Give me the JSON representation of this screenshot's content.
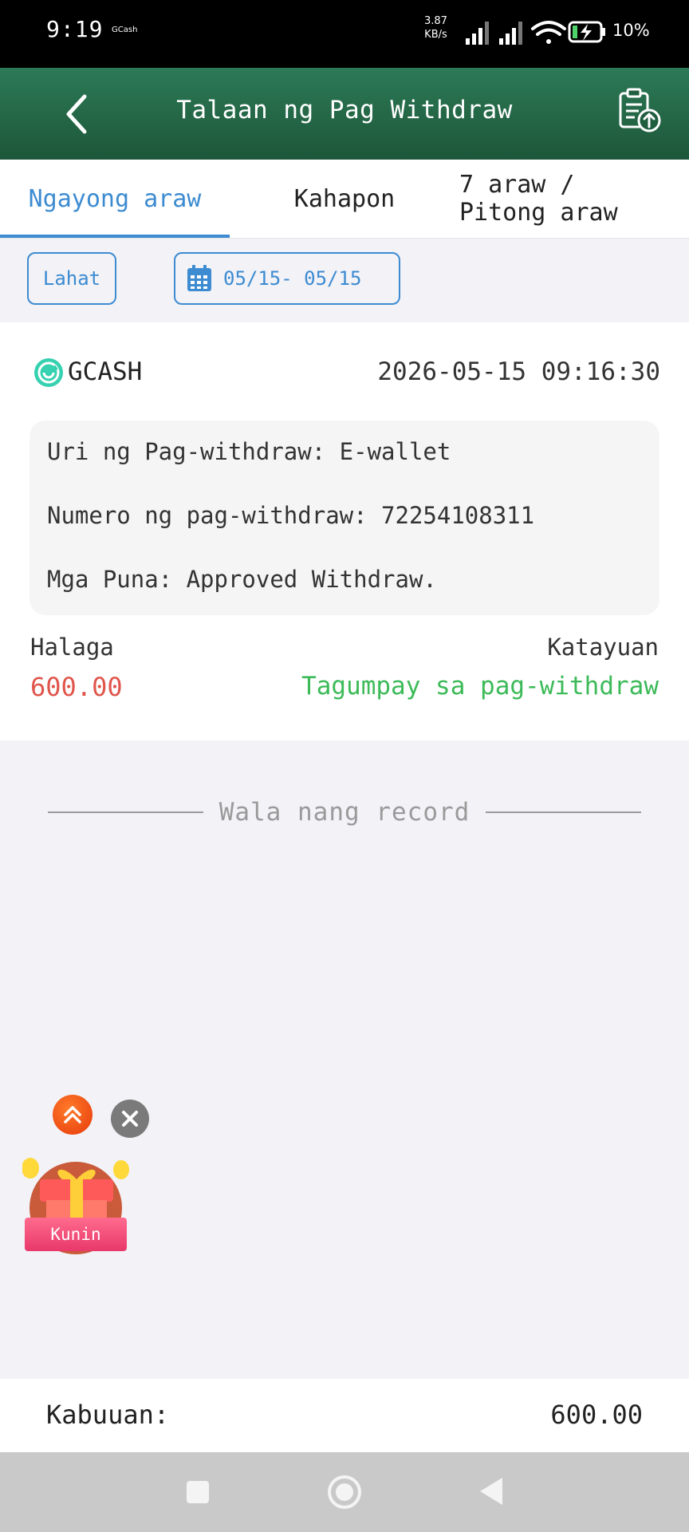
{
  "status_bar": {
    "time": "9:19",
    "app": "GCash",
    "speed_value": "3.87",
    "speed_unit": "KB/s",
    "battery": "10%"
  },
  "header": {
    "title": "Talaan ng Pag Withdraw",
    "back_icon": "chevron-left-icon",
    "export_icon": "clipboard-upload-icon"
  },
  "tabs": [
    {
      "label": "Ngayong araw",
      "active": true
    },
    {
      "label": "Kahapon",
      "active": false
    },
    {
      "label_line1": "7 araw /",
      "label_line2": "Pitong araw",
      "active": false
    }
  ],
  "filters": {
    "all_label": "Lahat",
    "date_range": "05/15- 05/15",
    "date_icon": "calendar-icon"
  },
  "records": [
    {
      "method": "GCASH",
      "datetime": "2026-05-15 09:16:30",
      "type_line": "Uri ng Pag-withdraw: E-wallet",
      "number_line": "Numero ng pag-withdraw: 72254108311",
      "remarks_line": "Mga Puna: Approved Withdraw.",
      "amount_label": "Halaga",
      "amount": "600.00",
      "status_label": "Katayuan",
      "status": "Tagumpay sa pag-withdraw"
    }
  ],
  "empty_text": "Wala nang record",
  "floating": {
    "gift_label": "Kunin"
  },
  "total": {
    "label": "Kabuuan:",
    "value": "600.00"
  },
  "colors": {
    "accent": "#3d8bd1",
    "header": "#1f5e3e",
    "amount": "#e0554b",
    "success": "#3cba58"
  }
}
